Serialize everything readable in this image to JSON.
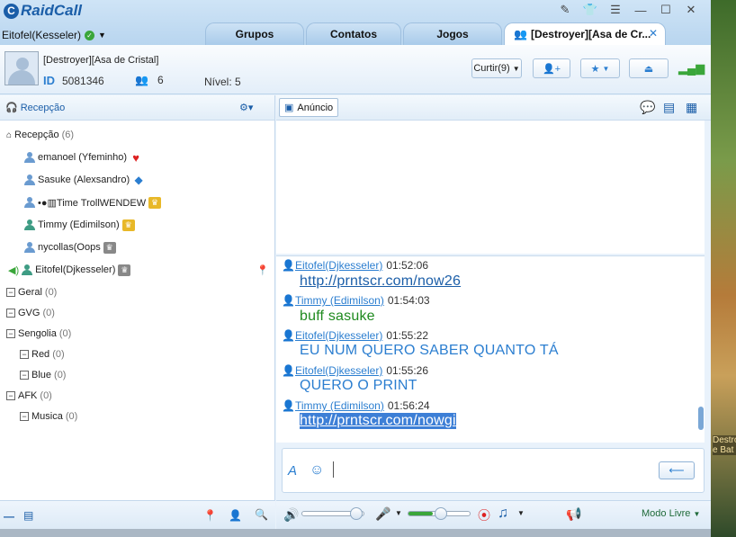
{
  "app": {
    "name": "RaidCall"
  },
  "user": {
    "name": "Eitofel(Kesseler)"
  },
  "tabs": [
    {
      "label": "Grupos"
    },
    {
      "label": "Contatos"
    },
    {
      "label": "Jogos"
    },
    {
      "label": "[Destroyer][Asa de Cr..."
    }
  ],
  "room": {
    "name": "[Destroyer][Asa de Cristal]",
    "id_label": "ID",
    "id": "5081346",
    "members": "6",
    "level": "Nível: 5",
    "like_label": "Curtir(9)"
  },
  "left": {
    "title": "Recepção",
    "tree": [
      {
        "label": "Recepção",
        "count": "(6)"
      },
      {
        "label": "emanoel (Yfeminho)"
      },
      {
        "label": "Sasuke (Alexsandro)"
      },
      {
        "label": "•●▥Time TrollWENDEW"
      },
      {
        "label": "Timmy (Edimilson)"
      },
      {
        "label": "nycollas(Oops"
      },
      {
        "label": "Eitofel(Djkesseler)"
      },
      {
        "label": "Geral",
        "count": "(0)"
      },
      {
        "label": "GVG",
        "count": "(0)"
      },
      {
        "label": "Sengolia",
        "count": "(0)"
      },
      {
        "label": "Red",
        "count": "(0)"
      },
      {
        "label": "Blue",
        "count": "(0)"
      },
      {
        "label": "AFK",
        "count": "(0)"
      },
      {
        "label": "Musica",
        "count": "(0)"
      }
    ]
  },
  "announce": {
    "label": "Anúncio"
  },
  "chat": [
    {
      "who": "Eitofel(Djkesseler)",
      "time": "01:52:06",
      "text": "http://prntscr.com/now26"
    },
    {
      "who": "Timmy (Edimilson)",
      "time": "01:54:03",
      "text": "buff sasuke"
    },
    {
      "who": "Eitofel(Djkesseler)",
      "time": "01:55:22",
      "text": "EU NUM QUERO SABER QUANTO TÁ"
    },
    {
      "who": "Eitofel(Djkesseler)",
      "time": "01:55:26",
      "text": "QUERO O PRINT"
    },
    {
      "who": "Timmy (Edimilson)",
      "time": "01:56:24",
      "text": "http://prntscr.com/nowgi"
    }
  ],
  "bottom": {
    "mode": "Modo Livre"
  },
  "background": {
    "text1": "Destroy",
    "text2": "e Bat"
  },
  "colors": {
    "accent": "#2b7ed0",
    "green_text": "#1f8a1f",
    "link": "#1b5ea8",
    "selection": "#3d7fd6"
  }
}
